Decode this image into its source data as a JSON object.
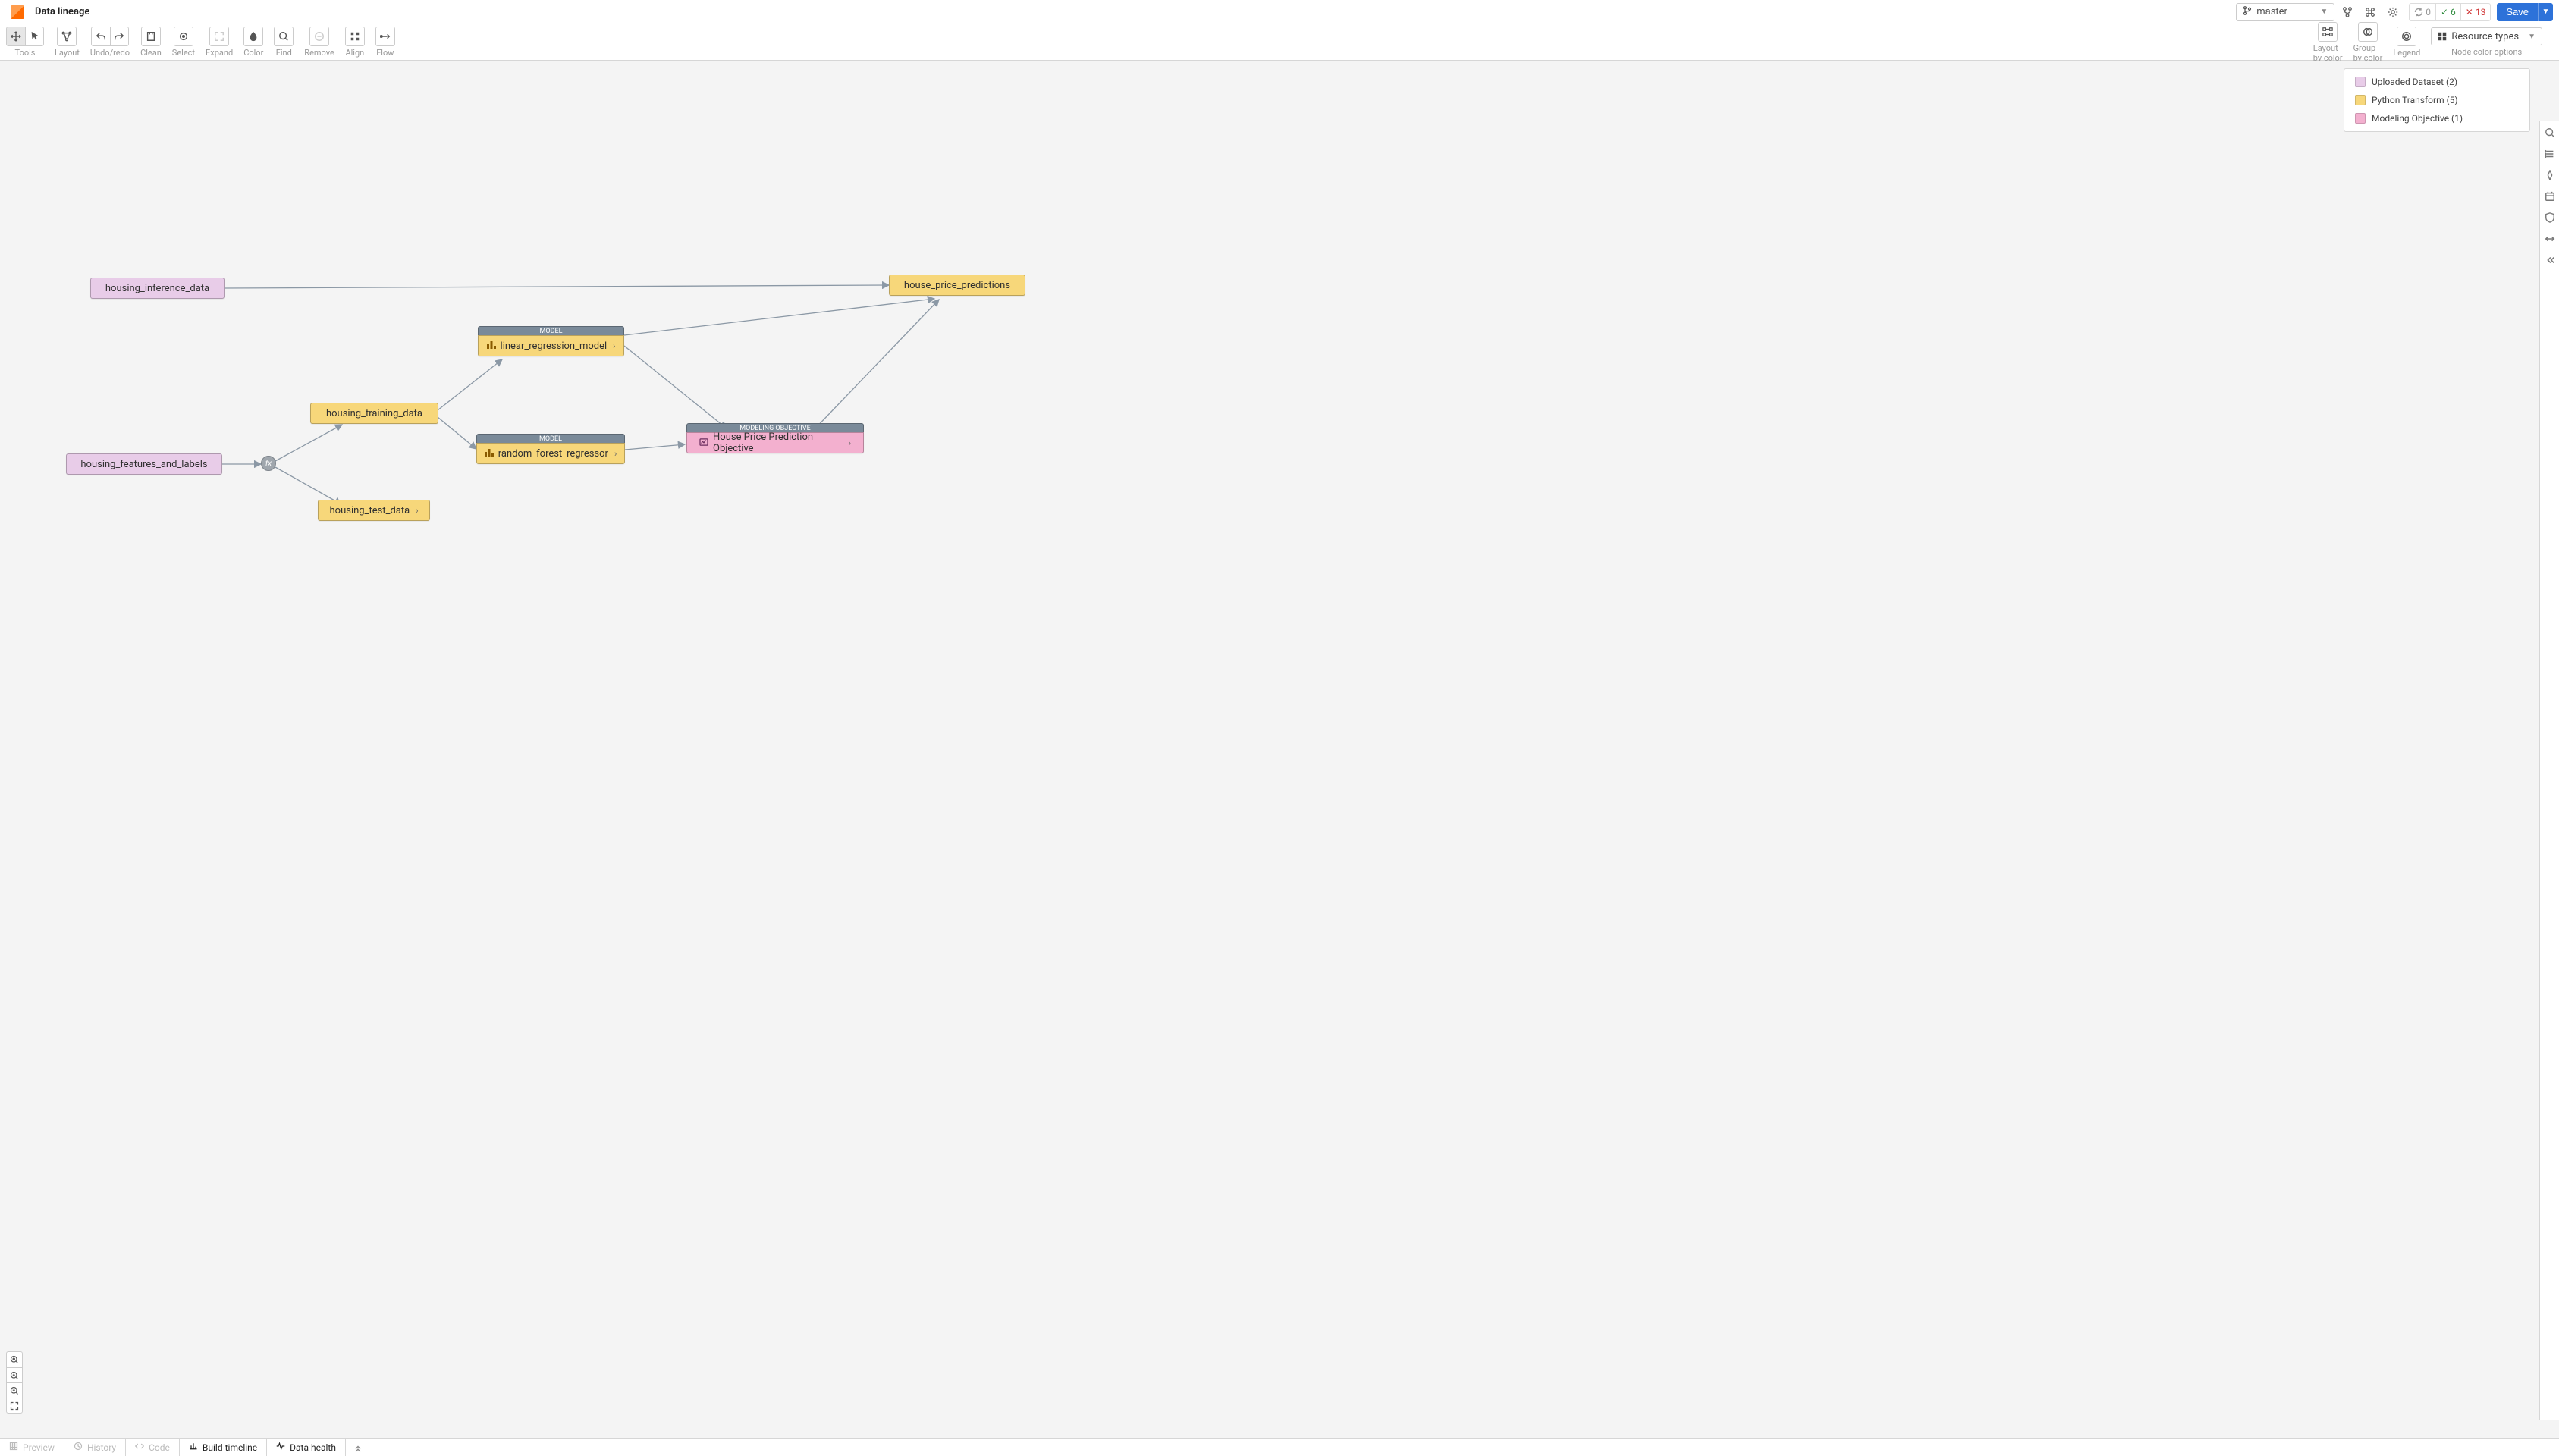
{
  "header": {
    "title": "Data lineage",
    "branch": "master",
    "status": {
      "sync": "0",
      "ok": "6",
      "err": "13"
    },
    "save_label": "Save"
  },
  "toolbar": {
    "groups_left": [
      {
        "label": "Tools",
        "buttons": [
          "move-icon",
          "select-arrow-icon"
        ]
      },
      {
        "label": "Layout",
        "buttons": [
          "layout-icon"
        ]
      },
      {
        "label": "Undo/redo",
        "buttons": [
          "undo-icon",
          "redo-icon"
        ]
      },
      {
        "label": "Clean",
        "buttons": [
          "clean-icon"
        ]
      },
      {
        "label": "Select",
        "buttons": [
          "target-icon"
        ]
      },
      {
        "label": "Expand",
        "buttons": [
          "expand-icon"
        ]
      },
      {
        "label": "Color",
        "buttons": [
          "color-icon"
        ]
      },
      {
        "label": "Find",
        "buttons": [
          "find-icon"
        ]
      },
      {
        "label": "Remove",
        "buttons": [
          "remove-icon"
        ]
      },
      {
        "label": "Align",
        "buttons": [
          "align-icon"
        ]
      },
      {
        "label": "Flow",
        "buttons": [
          "flow-icon"
        ]
      }
    ],
    "groups_right": [
      {
        "label": "Layout\nby color",
        "buttons": [
          "layout-color-icon"
        ]
      },
      {
        "label": "Group\nby color",
        "buttons": [
          "group-color-icon"
        ]
      },
      {
        "label": "Legend",
        "buttons": [
          "legend-icon"
        ]
      }
    ],
    "resource_types_label": "Resource types",
    "node_color_label": "Node color options"
  },
  "legend": [
    {
      "label": "Uploaded Dataset (2)",
      "color": "#e8cce8"
    },
    {
      "label": "Python Transform (5)",
      "color": "#f7d77a"
    },
    {
      "label": "Modeling Objective (1)",
      "color": "#f3b0cf"
    }
  ],
  "nodes": {
    "inference": "housing_inference_data",
    "features": "housing_features_and_labels",
    "training": "housing_training_data",
    "test": "housing_test_data",
    "linreg": "linear_regression_model",
    "linreg_header": "MODEL",
    "rf": "random_forest_regressor",
    "rf_header": "MODEL",
    "objective": "House Price Prediction Objective",
    "objective_header": "MODELING OBJECTIVE",
    "predictions": "house_price_predictions",
    "fx": "fx"
  },
  "footer": {
    "tabs": [
      {
        "label": "Preview",
        "disabled": true,
        "icon": "table-icon"
      },
      {
        "label": "History",
        "disabled": true,
        "icon": "history-icon"
      },
      {
        "label": "Code",
        "disabled": true,
        "icon": "code-icon"
      },
      {
        "label": "Build timeline",
        "disabled": false,
        "icon": "timeline-icon"
      },
      {
        "label": "Data health",
        "disabled": false,
        "icon": "pulse-icon"
      }
    ]
  }
}
